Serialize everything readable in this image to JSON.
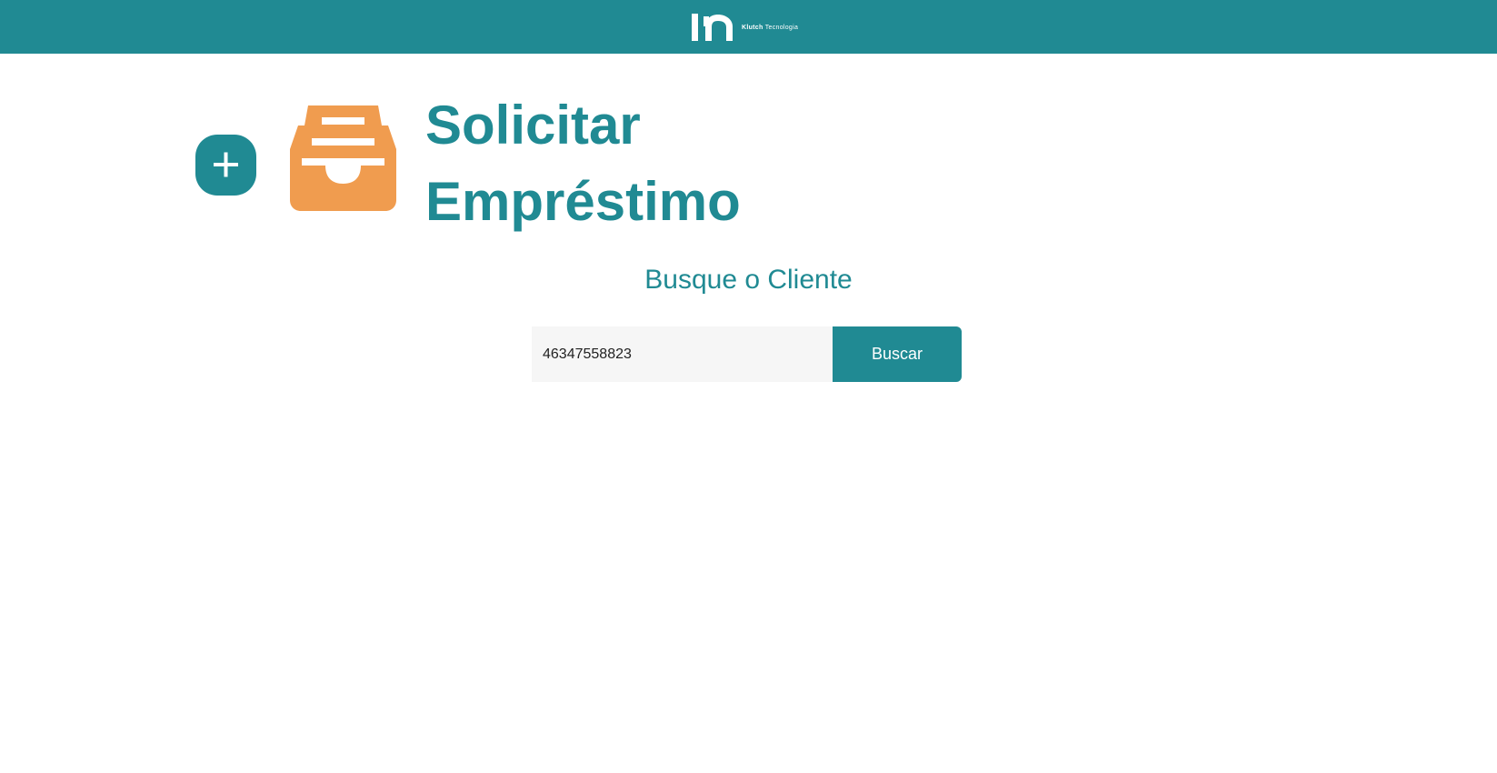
{
  "header": {
    "brand_name": "Klutch",
    "brand_tagline": "Tecnologia"
  },
  "main": {
    "title_line1": "Solicitar",
    "title_line2": "Empréstimo",
    "subtitle": "Busque o Cliente"
  },
  "search": {
    "value": "46347558823",
    "button_label": "Buscar"
  },
  "icons": {
    "add": "plus-icon",
    "section": "inbox-icon",
    "logo": "klutch-logo"
  },
  "colors": {
    "primary": "#208a93",
    "accent": "#f09c4f",
    "input_bg": "#f6f6f6",
    "background": "#ffffff"
  }
}
